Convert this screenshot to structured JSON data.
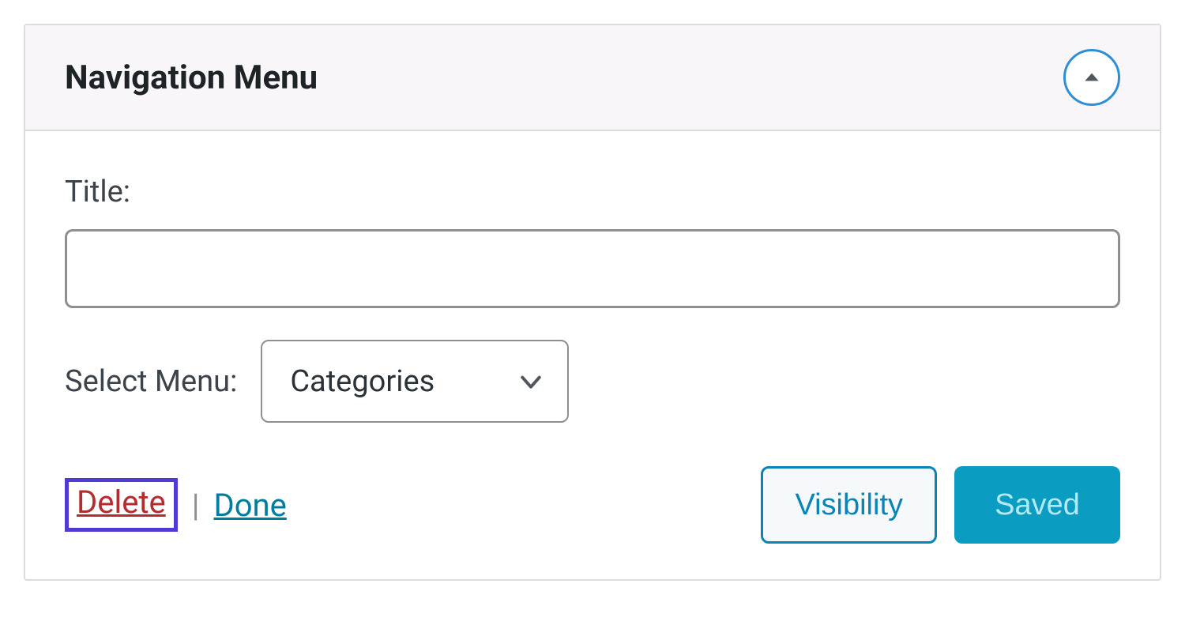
{
  "widget": {
    "title": "Navigation Menu"
  },
  "form": {
    "title_label": "Title:",
    "title_value": "",
    "select_label": "Select Menu:",
    "select_value": "Categories"
  },
  "actions": {
    "delete": "Delete",
    "separator": "|",
    "done": "Done",
    "visibility": "Visibility",
    "saved": "Saved"
  }
}
